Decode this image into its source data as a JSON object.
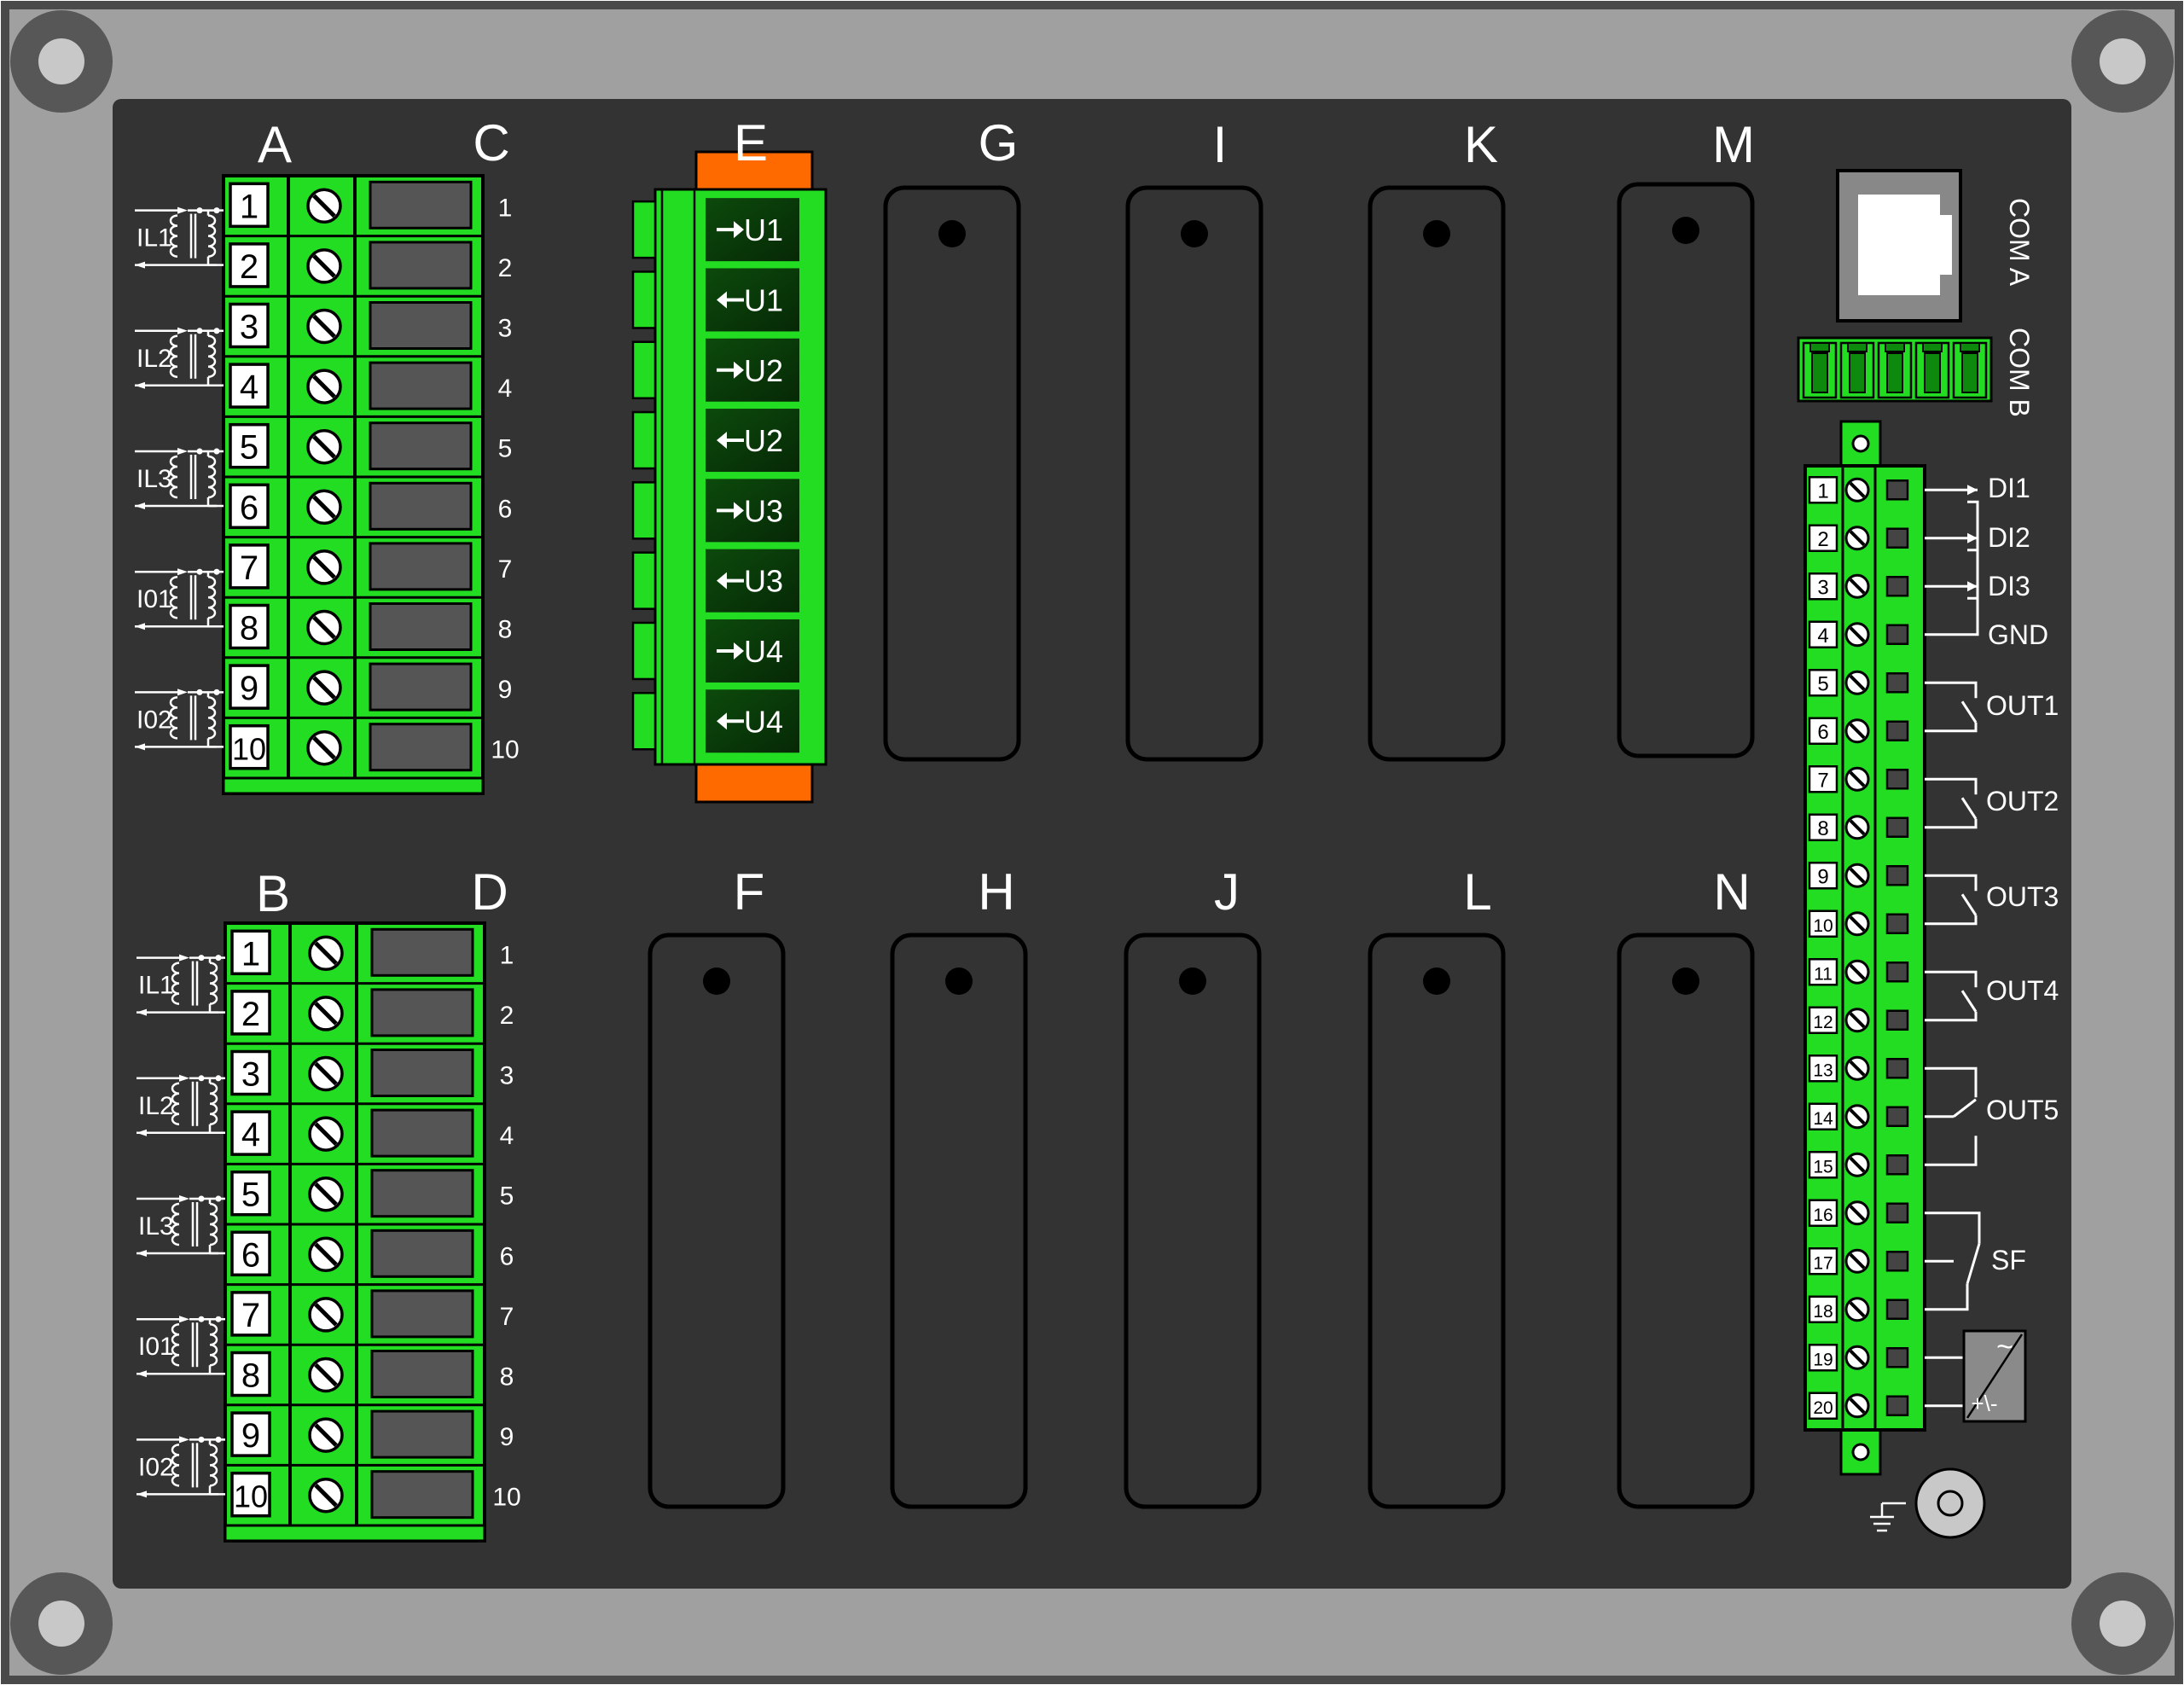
{
  "slot_letters": {
    "A": "A",
    "B": "B",
    "C": "C",
    "D": "D",
    "E": "E",
    "F": "F",
    "G": "G",
    "H": "H",
    "I": "I",
    "J": "J",
    "K": "K",
    "L": "L",
    "M": "M",
    "N": "N"
  },
  "terminal_numbers": [
    "1",
    "2",
    "3",
    "4",
    "5",
    "6",
    "7",
    "8",
    "9",
    "10"
  ],
  "ct_labels": [
    "IL1",
    "IL2",
    "IL3",
    "I01",
    "I02"
  ],
  "voltage_terminals": [
    "➔U1",
    "🡐U1",
    "➔U2",
    "🡐U2",
    "➔U3",
    "🡐U3",
    "➔U4",
    "🡐U4"
  ],
  "voltage_terminal_text": [
    {
      "arrow": "in",
      "label": "U1"
    },
    {
      "arrow": "out",
      "label": "U1"
    },
    {
      "arrow": "in",
      "label": "U2"
    },
    {
      "arrow": "out",
      "label": "U2"
    },
    {
      "arrow": "in",
      "label": "U3"
    },
    {
      "arrow": "out",
      "label": "U3"
    },
    {
      "arrow": "in",
      "label": "U4"
    },
    {
      "arrow": "out",
      "label": "U4"
    }
  ],
  "com_a": "COM A",
  "com_b": "COM B",
  "io_terminal_numbers": [
    "1",
    "2",
    "3",
    "4",
    "5",
    "6",
    "7",
    "8",
    "9",
    "10",
    "11",
    "12",
    "13",
    "14",
    "15",
    "16",
    "17",
    "18",
    "19",
    "20"
  ],
  "io_labels": {
    "di1": "DI1",
    "di2": "DI2",
    "di3": "DI3",
    "gnd": "GND",
    "out1": "OUT1",
    "out2": "OUT2",
    "out3": "OUT3",
    "out4": "OUT4",
    "out5": "OUT5",
    "sf": "SF"
  },
  "power_symbol": {
    "ac": "~",
    "dc": "+\\-"
  },
  "colors": {
    "frame": "#a0a0a0",
    "panel": "#333333",
    "terminal_green": "#22dd22",
    "terminal_dark": "#0a6e0a",
    "latch_orange": "#ff6a00",
    "text_white": "#ffffff"
  }
}
